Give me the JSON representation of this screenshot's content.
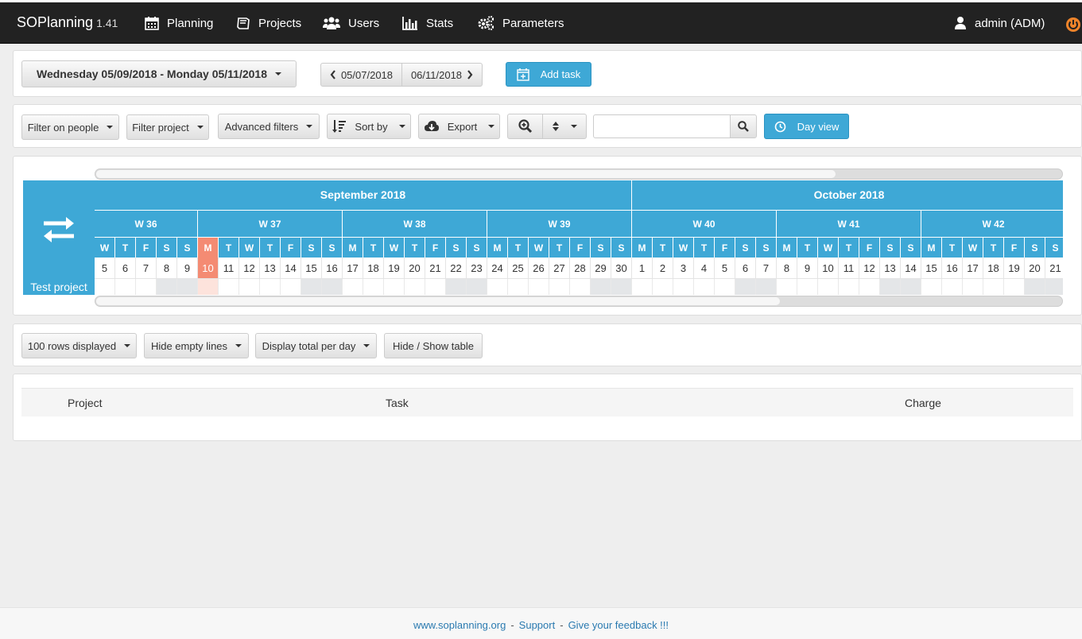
{
  "app": {
    "name": "SOPlanning",
    "version": "1.41"
  },
  "nav": {
    "planning": "Planning",
    "projects": "Projects",
    "users": "Users",
    "stats": "Stats",
    "parameters": "Parameters",
    "user": "admin (ADM)"
  },
  "toolbar1": {
    "date_range": "Wednesday 05/09/2018 - Monday 05/11/2018",
    "prev_date": "05/07/2018",
    "next_date": "06/11/2018",
    "add_task": "Add task"
  },
  "toolbar2": {
    "filter_people": "Filter on people",
    "filter_project": "Filter project",
    "advanced_filters": "Advanced filters",
    "sort_by": "Sort by",
    "export": "Export",
    "search_placeholder": "",
    "day_view": "Day view"
  },
  "planning": {
    "months": [
      "September 2018",
      "October 2018"
    ],
    "weeks": [
      "W 36",
      "W 37",
      "W 38",
      "W 39",
      "W 40",
      "W 41",
      "W 42"
    ],
    "days": [
      {
        "l": "W",
        "n": "5"
      },
      {
        "l": "T",
        "n": "6"
      },
      {
        "l": "F",
        "n": "7"
      },
      {
        "l": "S",
        "n": "8"
      },
      {
        "l": "S",
        "n": "9"
      },
      {
        "l": "M",
        "n": "10",
        "today": true
      },
      {
        "l": "T",
        "n": "11"
      },
      {
        "l": "W",
        "n": "12"
      },
      {
        "l": "T",
        "n": "13"
      },
      {
        "l": "F",
        "n": "14"
      },
      {
        "l": "S",
        "n": "15"
      },
      {
        "l": "S",
        "n": "16"
      },
      {
        "l": "M",
        "n": "17"
      },
      {
        "l": "T",
        "n": "18"
      },
      {
        "l": "W",
        "n": "19"
      },
      {
        "l": "T",
        "n": "20"
      },
      {
        "l": "F",
        "n": "21"
      },
      {
        "l": "S",
        "n": "22"
      },
      {
        "l": "S",
        "n": "23"
      },
      {
        "l": "M",
        "n": "24"
      },
      {
        "l": "T",
        "n": "25"
      },
      {
        "l": "W",
        "n": "26"
      },
      {
        "l": "T",
        "n": "27"
      },
      {
        "l": "F",
        "n": "28"
      },
      {
        "l": "S",
        "n": "29"
      },
      {
        "l": "S",
        "n": "30"
      },
      {
        "l": "M",
        "n": "1"
      },
      {
        "l": "T",
        "n": "2"
      },
      {
        "l": "W",
        "n": "3"
      },
      {
        "l": "T",
        "n": "4"
      },
      {
        "l": "F",
        "n": "5"
      },
      {
        "l": "S",
        "n": "6"
      },
      {
        "l": "S",
        "n": "7"
      },
      {
        "l": "M",
        "n": "8"
      },
      {
        "l": "T",
        "n": "9"
      },
      {
        "l": "W",
        "n": "10"
      },
      {
        "l": "T",
        "n": "11"
      },
      {
        "l": "F",
        "n": "12"
      },
      {
        "l": "S",
        "n": "13"
      },
      {
        "l": "S",
        "n": "14"
      },
      {
        "l": "M",
        "n": "15"
      },
      {
        "l": "T",
        "n": "16"
      },
      {
        "l": "W",
        "n": "17"
      },
      {
        "l": "T",
        "n": "18"
      },
      {
        "l": "F",
        "n": "19"
      },
      {
        "l": "S",
        "n": "20"
      },
      {
        "l": "S",
        "n": "21"
      }
    ],
    "rows": [
      "Test project"
    ]
  },
  "toolbar3": {
    "rows_displayed": "100 rows displayed",
    "hide_empty": "Hide empty lines",
    "display_total": "Display total per day",
    "hide_show_table": "Hide / Show table"
  },
  "table": {
    "headers": [
      "Project",
      "Task",
      "Charge"
    ]
  },
  "footer": {
    "site": "www.soplanning.org",
    "support": "Support",
    "feedback": "Give your feedback !!!",
    "sep": "-"
  },
  "colors": {
    "accent": "#3ea8d6",
    "today": "#f48b73",
    "topbar": "#222222",
    "weekend": "#e4e6e8"
  }
}
